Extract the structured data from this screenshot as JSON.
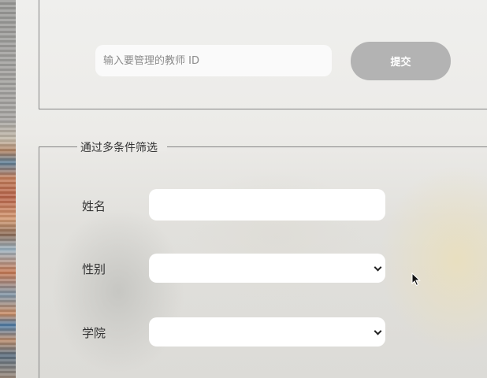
{
  "search": {
    "placeholder": "输入要管理的教师 ID",
    "submit_label": "提交"
  },
  "filter": {
    "legend": "通过多条件筛选",
    "fields": [
      {
        "label": "姓名",
        "type": "text",
        "value": ""
      },
      {
        "label": "性别",
        "type": "select",
        "value": ""
      },
      {
        "label": "学院",
        "type": "select",
        "value": ""
      }
    ]
  },
  "icons": {
    "select_arrow": "chevron-down-icon",
    "pointer": "mouse-cursor-icon"
  },
  "colors": {
    "submit_button": "#b3b3b3",
    "input_background": "#ffffff",
    "border": "#858585"
  }
}
